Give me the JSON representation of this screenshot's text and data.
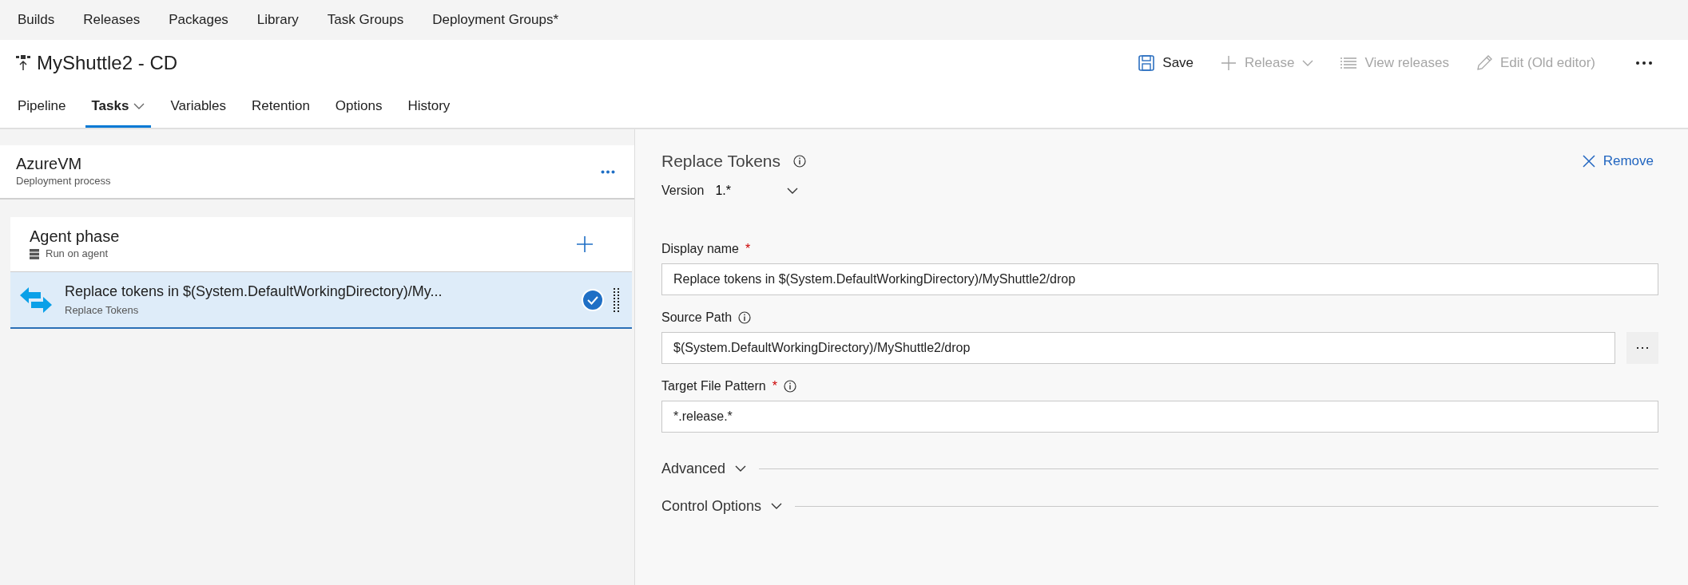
{
  "nav": [
    {
      "label": "Builds"
    },
    {
      "label": "Releases"
    },
    {
      "label": "Packages"
    },
    {
      "label": "Library"
    },
    {
      "label": "Task Groups"
    },
    {
      "label": "Deployment Groups*"
    }
  ],
  "title": "MyShuttle2 - CD",
  "toolbar": [
    {
      "kind": "save",
      "label": "Save",
      "disabled": false
    },
    {
      "kind": "release",
      "label": "Release",
      "disabled": true
    },
    {
      "kind": "list",
      "label": "View releases",
      "disabled": true
    },
    {
      "kind": "edit",
      "label": "Edit (Old editor)",
      "disabled": true
    },
    {
      "kind": "more"
    }
  ],
  "tabs": [
    {
      "label": "Pipeline",
      "selected": false,
      "menu": false
    },
    {
      "label": "Tasks",
      "selected": true,
      "menu": true
    },
    {
      "label": "Variables",
      "selected": false,
      "menu": false
    },
    {
      "label": "Retention",
      "selected": false,
      "menu": false
    },
    {
      "label": "Options",
      "selected": false,
      "menu": false
    },
    {
      "label": "History",
      "selected": false,
      "menu": false
    }
  ],
  "stage": {
    "name": "AzureVM",
    "subtitle": "Deployment process"
  },
  "phase": {
    "name": "Agent phase",
    "subtitle": "Run on agent"
  },
  "tasks": [
    {
      "title": "Replace tokens in $(System.DefaultWorkingDirectory)/My...",
      "subtitle": "Replace Tokens",
      "selected": true,
      "enabled": true
    }
  ],
  "detail": {
    "title": "Replace Tokens",
    "remove": "Remove",
    "version_label": "Version",
    "version": "1.*",
    "fields": [
      {
        "kind": "text",
        "label": "Display name",
        "required_mark": "*",
        "info": false,
        "value": "Replace tokens in $(System.DefaultWorkingDirectory)/MyShuttle2/drop"
      },
      {
        "kind": "path",
        "label": "Source Path",
        "info": true,
        "value": "$(System.DefaultWorkingDirectory)/MyShuttle2/drop",
        "browse": "···"
      },
      {
        "kind": "text",
        "label": "Target File Pattern",
        "required_mark": "*",
        "info": true,
        "value": "*.release.*"
      }
    ],
    "sections": [
      {
        "label": "Advanced",
        "expanded": false
      },
      {
        "label": "Control Options",
        "expanded": false
      }
    ]
  }
}
